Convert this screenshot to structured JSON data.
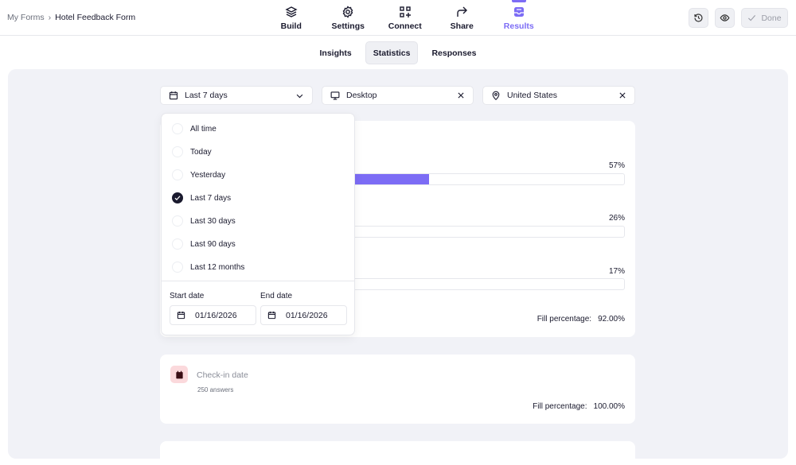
{
  "breadcrumb": {
    "parent": "My Forms",
    "separator": "›",
    "current": "Hotel Feedback Form"
  },
  "nav": [
    {
      "label": "Build",
      "icon": "layers-icon"
    },
    {
      "label": "Settings",
      "icon": "gear-icon"
    },
    {
      "label": "Connect",
      "icon": "connect-icon"
    },
    {
      "label": "Share",
      "icon": "share-icon"
    },
    {
      "label": "Results",
      "icon": "inbox-icon",
      "active": true
    }
  ],
  "actions": {
    "done_label": "Done"
  },
  "subtabs": [
    {
      "label": "Insights"
    },
    {
      "label": "Statistics",
      "active": true
    },
    {
      "label": "Responses"
    }
  ],
  "filters": {
    "date": "Last 7 days",
    "device": "Desktop",
    "location": "United States"
  },
  "date_menu": {
    "options": [
      "All time",
      "Today",
      "Yesterday",
      "Last 7 days",
      "Last 30 days",
      "Last 90 days",
      "Last 12 months"
    ],
    "selected": "Last 7 days",
    "start_label": "Start date",
    "end_label": "End date",
    "start_value": "01/16/2026",
    "end_value": "01/16/2026"
  },
  "card1": {
    "bars": [
      {
        "pct_label": "57%",
        "value": 57
      },
      {
        "pct_label": "26%",
        "value": 26
      },
      {
        "pct_label": "17%",
        "value": 17
      }
    ],
    "fill_label": "Fill percentage:",
    "fill_value": "92.00%"
  },
  "card2": {
    "title": "Check-in date",
    "answers": "250 answers",
    "fill_label": "Fill percentage:",
    "fill_value": "100.00%"
  },
  "colors": {
    "accent": "#7c6cf5",
    "panel": "#f1f2f7"
  }
}
